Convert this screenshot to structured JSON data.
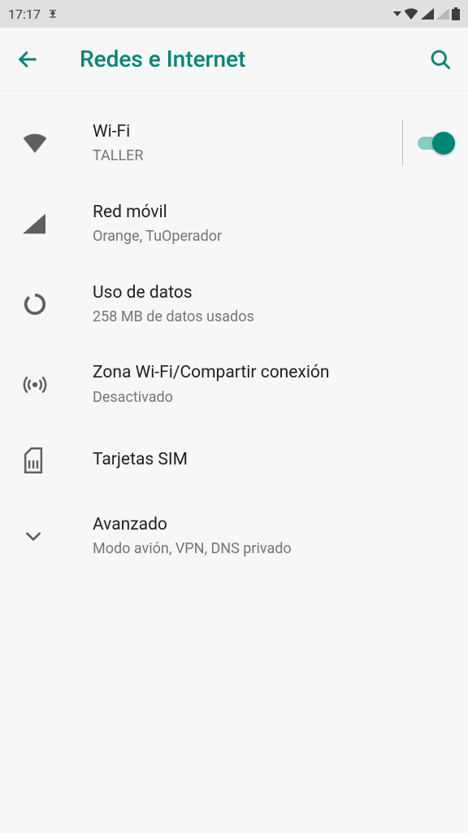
{
  "status_bar": {
    "time": "17:17"
  },
  "header": {
    "title": "Redes e Internet"
  },
  "items": {
    "wifi": {
      "title": "Wi-Fi",
      "subtitle": "TALLER",
      "enabled": true
    },
    "mobile": {
      "title": "Red móvil",
      "subtitle": "Orange, TuOperador"
    },
    "data_usage": {
      "title": "Uso de datos",
      "subtitle": "258 MB de datos usados"
    },
    "hotspot": {
      "title": "Zona Wi-Fi/Compartir conexión",
      "subtitle": "Desactivado"
    },
    "sim": {
      "title": "Tarjetas SIM"
    },
    "advanced": {
      "title": "Avanzado",
      "subtitle": "Modo avión, VPN, DNS privado"
    }
  },
  "colors": {
    "accent": "#008577"
  }
}
